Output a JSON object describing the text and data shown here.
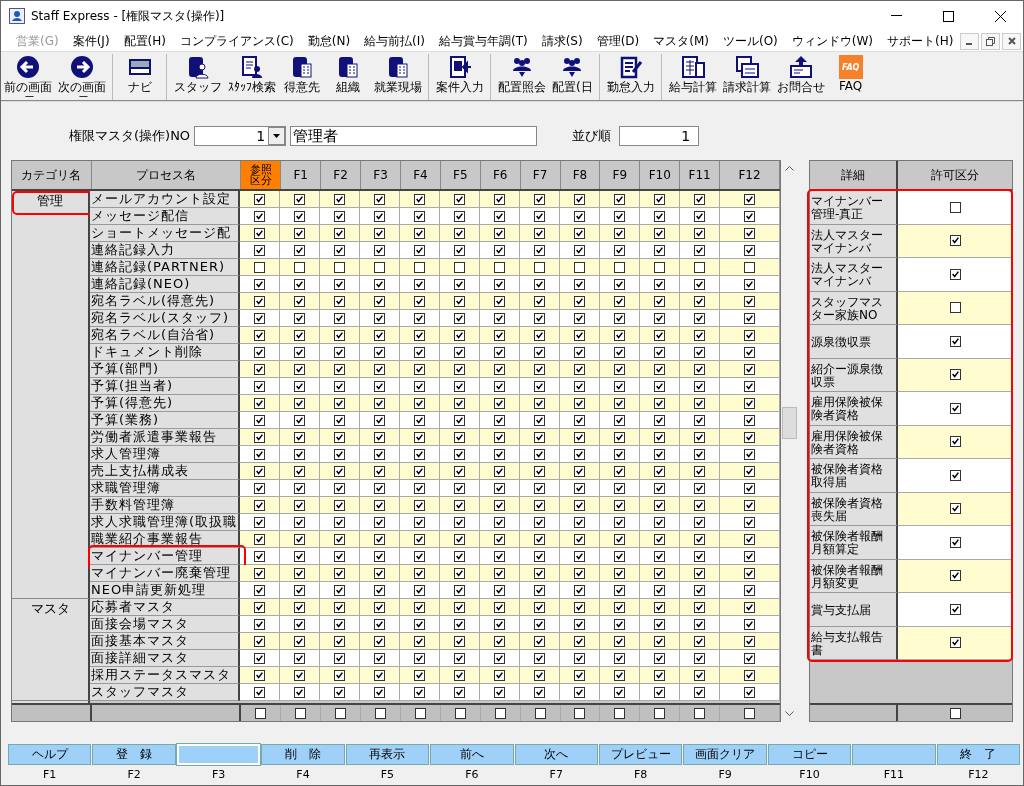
{
  "window": {
    "title": "Staff Express - [権限マスタ(操作)]"
  },
  "menu": [
    {
      "label": "営業(G)",
      "disabled": true
    },
    {
      "label": "案件(J)",
      "disabled": false
    },
    {
      "label": "配置(H)",
      "disabled": false
    },
    {
      "label": "コンプライアンス(C)",
      "disabled": false
    },
    {
      "label": "勤怠(N)",
      "disabled": false
    },
    {
      "label": "給与前払(I)",
      "disabled": false
    },
    {
      "label": "給与賞与年調(T)",
      "disabled": false
    },
    {
      "label": "請求(S)",
      "disabled": false
    },
    {
      "label": "管理(D)",
      "disabled": false
    },
    {
      "label": "マスタ(M)",
      "disabled": false
    },
    {
      "label": "ツール(O)",
      "disabled": false
    },
    {
      "label": "ウィンドウ(W)",
      "disabled": false
    },
    {
      "label": "サポート(H)",
      "disabled": false
    }
  ],
  "toolbar": [
    {
      "label": "前の画面",
      "kind": "back",
      "dropdown": true,
      "separator_after": false
    },
    {
      "label": "次の画面",
      "kind": "forward",
      "dropdown": true,
      "separator_after": true
    },
    {
      "label": "ナビ",
      "kind": "keyboard",
      "dropdown": false,
      "separator_after": true
    },
    {
      "label": "スタッフ",
      "kind": "person",
      "dropdown": false,
      "separator_after": false
    },
    {
      "label": "ｽﾀｯﾌ検索",
      "kind": "document",
      "dropdown": false,
      "separator_after": false
    },
    {
      "label": "得意先",
      "kind": "building",
      "dropdown": false,
      "separator_after": false
    },
    {
      "label": "組織",
      "kind": "building",
      "dropdown": false,
      "separator_after": false
    },
    {
      "label": "就業現場",
      "kind": "building",
      "dropdown": false,
      "separator_after": true
    },
    {
      "label": "案件入力",
      "kind": "entry",
      "dropdown": false,
      "separator_after": true
    },
    {
      "label": "配置照会",
      "kind": "people",
      "dropdown": false,
      "separator_after": false
    },
    {
      "label": "配置(日",
      "kind": "people",
      "dropdown": false,
      "separator_after": true
    },
    {
      "label": "勤怠入力",
      "kind": "edit",
      "dropdown": false,
      "separator_after": true
    },
    {
      "label": "給与計算",
      "kind": "calculator",
      "dropdown": false,
      "separator_after": false
    },
    {
      "label": "請求計算",
      "kind": "invoice",
      "dropdown": false,
      "separator_after": false
    },
    {
      "label": "お問合せ",
      "kind": "upload",
      "dropdown": false,
      "separator_after": false
    },
    {
      "label": "FAQ",
      "kind": "faq",
      "badge": "FAQ",
      "dropdown": false,
      "separator_after": false
    }
  ],
  "form": {
    "no_label": "権限マスタ(操作)NO",
    "no_value": "1",
    "name_value": "管理者",
    "order_label": "並び順",
    "order_value": "1"
  },
  "table": {
    "columns": [
      "カテゴリ名",
      "プロセス名",
      "参照区分",
      "F1",
      "F2",
      "F3",
      "F4",
      "F5",
      "F6",
      "F7",
      "F8",
      "F9",
      "F10",
      "F11",
      "F12"
    ],
    "categories": [
      {
        "name": "管理",
        "highlighted": true,
        "rows": [
          {
            "name": "メールアカウント設定",
            "highlighted": false,
            "checks": [
              true,
              true,
              true,
              true,
              true,
              true,
              true,
              true,
              true,
              true,
              true,
              true,
              true
            ]
          },
          {
            "name": "メッセージ配信",
            "highlighted": false,
            "checks": [
              true,
              true,
              true,
              true,
              true,
              true,
              true,
              true,
              true,
              true,
              true,
              true,
              true
            ]
          },
          {
            "name": "ショートメッセージ配",
            "highlighted": false,
            "checks": [
              true,
              true,
              true,
              true,
              true,
              true,
              true,
              true,
              true,
              true,
              true,
              true,
              true
            ]
          },
          {
            "name": "連絡記録入力",
            "highlighted": false,
            "checks": [
              true,
              true,
              true,
              true,
              true,
              true,
              true,
              true,
              true,
              true,
              true,
              true,
              true
            ]
          },
          {
            "name": "連絡記録(PARTNER)",
            "highlighted": false,
            "checks": [
              false,
              false,
              false,
              false,
              false,
              false,
              false,
              false,
              false,
              false,
              false,
              false,
              false
            ]
          },
          {
            "name": "連絡記録(NEO)",
            "highlighted": false,
            "checks": [
              true,
              true,
              true,
              true,
              true,
              true,
              true,
              true,
              true,
              true,
              true,
              true,
              true
            ]
          },
          {
            "name": "宛名ラベル(得意先)",
            "highlighted": false,
            "checks": [
              true,
              true,
              true,
              true,
              true,
              true,
              true,
              true,
              true,
              true,
              true,
              true,
              true
            ]
          },
          {
            "name": "宛名ラベル(スタッフ)",
            "highlighted": false,
            "checks": [
              true,
              true,
              true,
              true,
              true,
              true,
              true,
              true,
              true,
              true,
              true,
              true,
              true
            ]
          },
          {
            "name": "宛名ラベル(自治省)",
            "highlighted": false,
            "checks": [
              true,
              true,
              true,
              true,
              true,
              true,
              true,
              true,
              true,
              true,
              true,
              true,
              true
            ]
          },
          {
            "name": "ドキュメント削除",
            "highlighted": false,
            "checks": [
              true,
              true,
              true,
              true,
              true,
              true,
              true,
              true,
              true,
              true,
              true,
              true,
              true
            ]
          },
          {
            "name": "予算(部門)",
            "highlighted": false,
            "checks": [
              true,
              true,
              true,
              true,
              true,
              true,
              true,
              true,
              true,
              true,
              true,
              true,
              true
            ]
          },
          {
            "name": "予算(担当者)",
            "highlighted": false,
            "checks": [
              true,
              true,
              true,
              true,
              true,
              true,
              true,
              true,
              true,
              true,
              true,
              true,
              true
            ]
          },
          {
            "name": "予算(得意先)",
            "highlighted": false,
            "checks": [
              true,
              true,
              true,
              true,
              true,
              true,
              true,
              true,
              true,
              true,
              true,
              true,
              true
            ]
          },
          {
            "name": "予算(業務)",
            "highlighted": false,
            "checks": [
              true,
              true,
              true,
              true,
              true,
              true,
              true,
              true,
              true,
              true,
              true,
              true,
              true
            ]
          },
          {
            "name": "労働者派遣事業報告",
            "highlighted": false,
            "checks": [
              true,
              true,
              true,
              true,
              true,
              true,
              true,
              true,
              true,
              true,
              true,
              true,
              true
            ]
          },
          {
            "name": "求人管理簿",
            "highlighted": false,
            "checks": [
              true,
              true,
              true,
              true,
              true,
              true,
              true,
              true,
              true,
              true,
              true,
              true,
              true
            ]
          },
          {
            "name": "売上支払構成表",
            "highlighted": false,
            "checks": [
              true,
              true,
              true,
              true,
              true,
              true,
              true,
              true,
              true,
              true,
              true,
              true,
              true
            ]
          },
          {
            "name": "求職管理簿",
            "highlighted": false,
            "checks": [
              true,
              true,
              true,
              true,
              true,
              true,
              true,
              true,
              true,
              true,
              true,
              true,
              true
            ]
          },
          {
            "name": "手数料管理簿",
            "highlighted": false,
            "checks": [
              true,
              true,
              true,
              true,
              true,
              true,
              true,
              true,
              true,
              true,
              true,
              true,
              true
            ]
          },
          {
            "name": "求人求職管理簿(取扱職",
            "highlighted": false,
            "checks": [
              true,
              true,
              true,
              true,
              true,
              true,
              true,
              true,
              true,
              true,
              true,
              true,
              true
            ]
          },
          {
            "name": "職業紹介事業報告",
            "highlighted": false,
            "checks": [
              true,
              true,
              true,
              true,
              true,
              true,
              true,
              true,
              true,
              true,
              true,
              true,
              true
            ]
          },
          {
            "name": "マイナンバー管理",
            "highlighted": true,
            "checks": [
              true,
              true,
              true,
              true,
              true,
              true,
              true,
              true,
              true,
              true,
              true,
              true,
              true
            ]
          },
          {
            "name": "マイナンバー廃棄管理",
            "highlighted": false,
            "checks": [
              true,
              true,
              true,
              true,
              true,
              true,
              true,
              true,
              true,
              true,
              true,
              true,
              true
            ]
          },
          {
            "name": "NEO申請更新処理",
            "highlighted": false,
            "checks": [
              true,
              true,
              true,
              true,
              true,
              true,
              true,
              true,
              true,
              true,
              true,
              true,
              true
            ]
          }
        ]
      },
      {
        "name": "マスタ",
        "highlighted": false,
        "rows": [
          {
            "name": "応募者マスタ",
            "highlighted": false,
            "checks": [
              true,
              true,
              true,
              true,
              true,
              true,
              true,
              true,
              true,
              true,
              true,
              true,
              true
            ]
          },
          {
            "name": "面接会場マスタ",
            "highlighted": false,
            "checks": [
              true,
              true,
              true,
              true,
              true,
              true,
              true,
              true,
              true,
              true,
              true,
              true,
              true
            ]
          },
          {
            "name": "面接基本マスタ",
            "highlighted": false,
            "checks": [
              true,
              true,
              true,
              true,
              true,
              true,
              true,
              true,
              true,
              true,
              true,
              true,
              true
            ]
          },
          {
            "name": "面接詳細マスタ",
            "highlighted": false,
            "checks": [
              true,
              true,
              true,
              true,
              true,
              true,
              true,
              true,
              true,
              true,
              true,
              true,
              true
            ]
          },
          {
            "name": "採用ステータスマスタ",
            "highlighted": false,
            "checks": [
              true,
              true,
              true,
              true,
              true,
              true,
              true,
              true,
              true,
              true,
              true,
              true,
              true
            ]
          },
          {
            "name": "スタッフマスタ",
            "highlighted": false,
            "checks": [
              true,
              true,
              true,
              true,
              true,
              true,
              true,
              true,
              true,
              true,
              true,
              true,
              true
            ]
          }
        ]
      }
    ],
    "footer_checks": [
      false,
      false,
      false,
      false,
      false,
      false,
      false,
      false,
      false,
      false,
      false,
      false,
      false
    ]
  },
  "detail": {
    "columns": [
      "詳細",
      "許可区分"
    ],
    "highlighted": true,
    "rows": [
      {
        "name": "マイナンバー管理-真正",
        "checked": false
      },
      {
        "name": "法人マスターマイナンバ",
        "checked": true
      },
      {
        "name": "法人マスターマイナンバ",
        "checked": true
      },
      {
        "name": "スタッフマスター家族NO",
        "checked": false
      },
      {
        "name": "源泉徴収票",
        "checked": true
      },
      {
        "name": "紹介ー源泉徴収票",
        "checked": true
      },
      {
        "name": "雇用保険被保険者資格",
        "checked": true
      },
      {
        "name": "雇用保険被保険者資格",
        "checked": true
      },
      {
        "name": "被保険者資格取得届",
        "checked": true
      },
      {
        "name": "被保険者資格喪失届",
        "checked": true
      },
      {
        "name": "被保険者報酬月額算定",
        "checked": true
      },
      {
        "name": "被保険者報酬月額変更",
        "checked": true
      },
      {
        "name": "賞与支払届",
        "checked": true
      },
      {
        "name": "給与支払報告書",
        "checked": true
      }
    ],
    "footer_checked": false
  },
  "function_keys": [
    {
      "label": "ヘルプ",
      "key": "F1",
      "selected": false
    },
    {
      "label": "登　録",
      "key": "F2",
      "selected": false
    },
    {
      "key": "F3",
      "selected": true
    },
    {
      "label": "削　除",
      "key": "F4",
      "selected": false
    },
    {
      "label": "再表示",
      "key": "F5",
      "selected": false
    },
    {
      "label": "前へ",
      "key": "F6",
      "selected": false
    },
    {
      "label": "次へ",
      "key": "F7",
      "selected": false
    },
    {
      "label": "プレビュー",
      "key": "F8",
      "selected": false
    },
    {
      "label": "画面クリア",
      "key": "F9",
      "selected": false
    },
    {
      "label": "コピー",
      "key": "F10",
      "selected": false
    },
    {
      "key": "F11",
      "selected": false
    },
    {
      "label": "終　了",
      "key": "F12",
      "selected": false
    }
  ]
}
